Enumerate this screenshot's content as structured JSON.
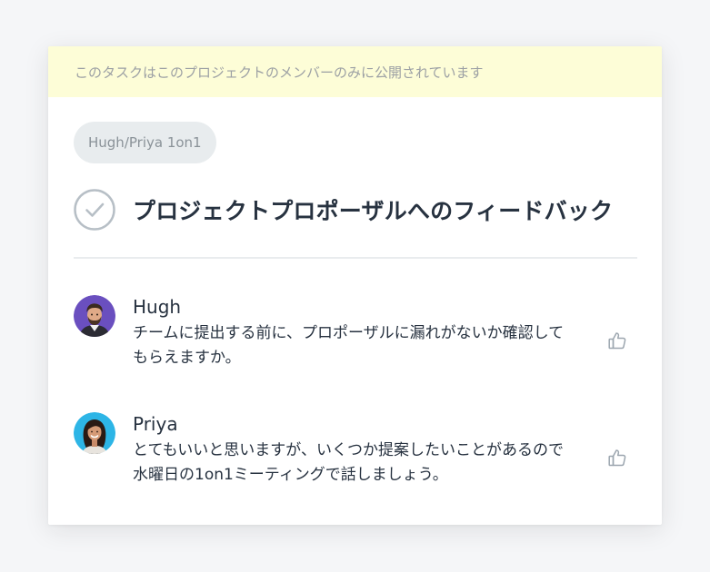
{
  "banner": {
    "text": "このタスクはこのプロジェクトのメンバーのみに公開されています"
  },
  "project": {
    "label": "Hugh/Priya 1on1"
  },
  "task": {
    "title": "プロジェクトプロポーザルへのフィードバック"
  },
  "comments": [
    {
      "author": "Hugh",
      "text": "チームに提出する前に、プロポーザルに漏れがないか確認してもらえますか。",
      "avatar_icon": "avatar-hugh",
      "like_icon": "thumbs-up-icon"
    },
    {
      "author": "Priya",
      "text": "とてもいいと思いますが、いくつか提案したいことがあるので水曜日の1on1ミーティングで話しましょう。",
      "avatar_icon": "avatar-priya",
      "like_icon": "thumbs-up-icon"
    }
  ],
  "colors": {
    "banner_bg": "#fdfdd7",
    "pill_bg": "#e8ecee",
    "check_stroke": "#b7bfc6",
    "divider": "#e9ecee",
    "hugh_avatar_bg": "#6a4fbf",
    "priya_avatar_bg": "#2db5e6"
  }
}
